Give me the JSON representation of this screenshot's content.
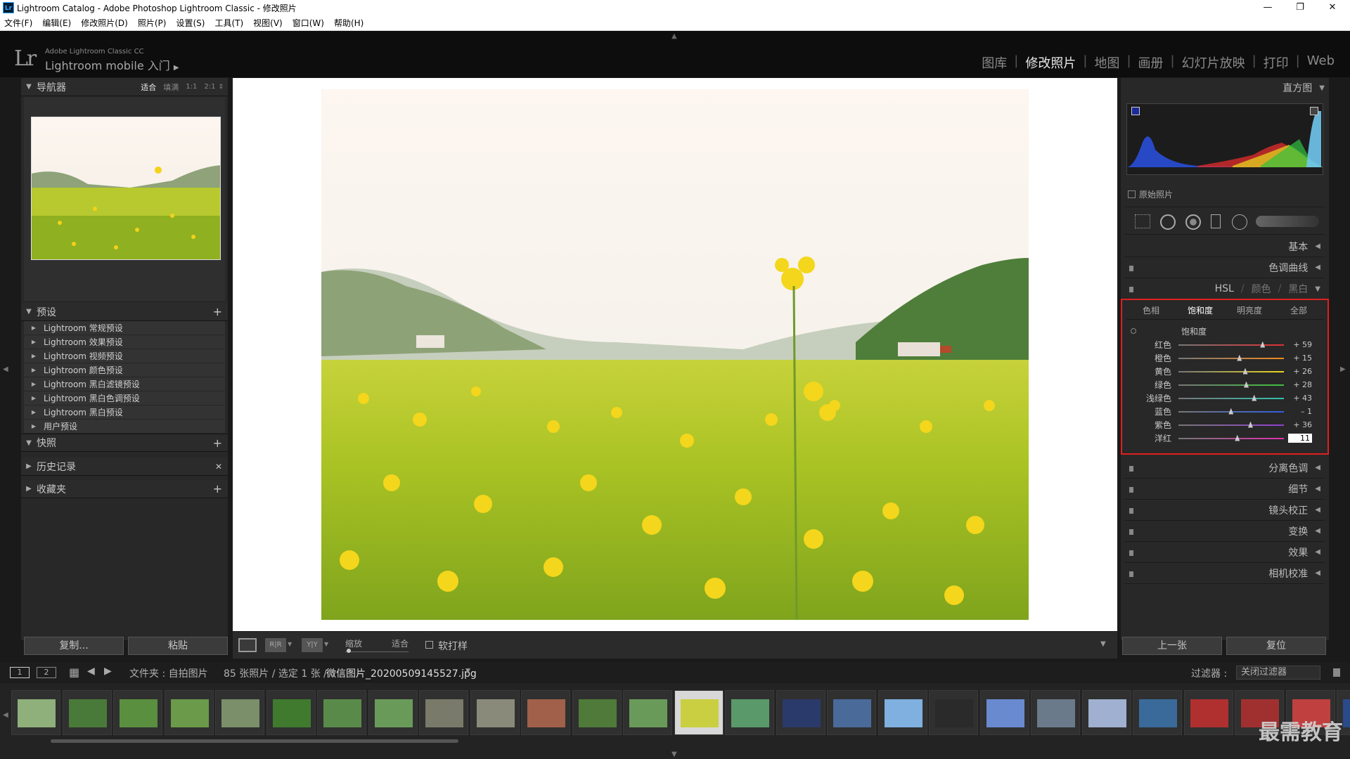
{
  "window": {
    "title": "Lightroom Catalog - Adobe Photoshop Lightroom Classic - 修改照片",
    "logo": "Lr"
  },
  "menu": [
    "文件(F)",
    "编辑(E)",
    "修改照片(D)",
    "照片(P)",
    "设置(S)",
    "工具(T)",
    "视图(V)",
    "窗口(W)",
    "帮助(H)"
  ],
  "brand": {
    "logo": "Lr",
    "small": "Adobe Lightroom Classic CC",
    "main": "Lightroom mobile 入门"
  },
  "modules": [
    "图库",
    "修改照片",
    "地图",
    "画册",
    "幻灯片放映",
    "打印",
    "Web"
  ],
  "active_module": "修改照片",
  "left": {
    "navigator": {
      "title": "导航器",
      "zoom": [
        "适合",
        "填满",
        "1:1",
        "2:1"
      ]
    },
    "presets": {
      "title": "预设",
      "items": [
        "Lightroom 常规预设",
        "Lightroom 效果预设",
        "Lightroom 视频预设",
        "Lightroom 颜色预设",
        "Lightroom 黑白滤镜预设",
        "Lightroom 黑白色调预设",
        "Lightroom 黑白预设",
        "用户预设"
      ]
    },
    "snapshots": "快照",
    "history": "历史记录",
    "collections": "收藏夹",
    "copy": "复制...",
    "paste": "粘贴"
  },
  "right": {
    "histogram": "直方图",
    "original": "原始照片",
    "basic": "基本",
    "tone_curve": "色调曲线",
    "hsl_header": {
      "hsl": "HSL",
      "color": "颜色",
      "bw": "黑白"
    },
    "hsl_tabs": [
      "色相",
      "饱和度",
      "明亮度",
      "全部"
    ],
    "hsl_active": "饱和度",
    "section_label": "饱和度",
    "sliders": [
      {
        "label": "红色",
        "value": "+ 59",
        "num": 59,
        "color": "#e03030"
      },
      {
        "label": "橙色",
        "value": "+ 15",
        "num": 15,
        "color": "#f08a20"
      },
      {
        "label": "黄色",
        "value": "+ 26",
        "num": 26,
        "color": "#e8d820"
      },
      {
        "label": "绿色",
        "value": "+ 28",
        "num": 28,
        "color": "#40c040"
      },
      {
        "label": "浅绿色",
        "value": "+ 43",
        "num": 43,
        "color": "#30c0b0"
      },
      {
        "label": "蓝色",
        "value": "– 1",
        "num": -1,
        "color": "#3060e0"
      },
      {
        "label": "紫色",
        "value": "+ 36",
        "num": 36,
        "color": "#9040d0"
      },
      {
        "label": "洋红",
        "value": "11",
        "num": 11,
        "color": "#e030b0"
      }
    ],
    "panels": [
      "分离色调",
      "细节",
      "镜头校正",
      "变换",
      "效果",
      "相机校准"
    ],
    "prev": "上一张",
    "reset": "复位"
  },
  "toolbar": {
    "zoom_label": "缩放",
    "fit": "适合",
    "soft_proof": "软打样"
  },
  "filmbar": {
    "page1": "1",
    "page2": "2",
    "path": "文件夹 : 自拍图片",
    "count": "85 张照片 / 选定 1 张 /",
    "file": "微信图片_20200509145527.jpg",
    "filter_label": "过滤器 :",
    "filter_value": "关闭过滤器"
  },
  "watermark": "最需教育",
  "colors": {
    "accent_red": "#e02020",
    "panel_bg": "#2b2b2b"
  }
}
